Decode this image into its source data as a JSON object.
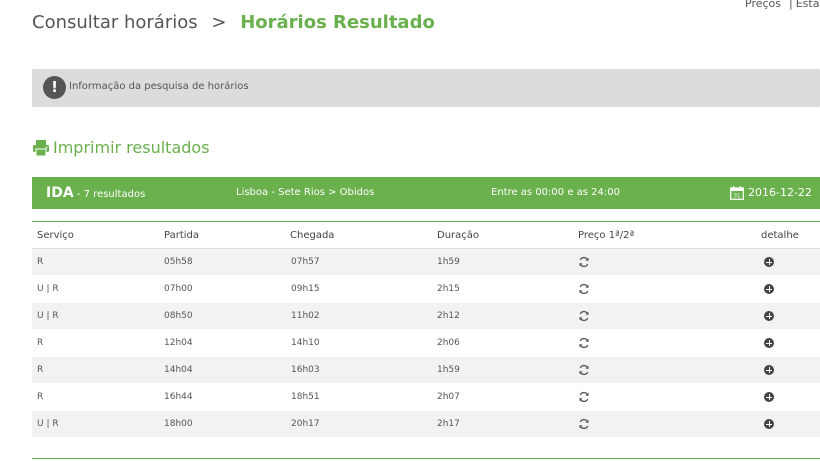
{
  "top_links": {
    "prices": "Preços",
    "stations": "Estaç"
  },
  "breadcrumb": {
    "root": "Consultar horários",
    "separator": ">",
    "current": "Horários Resultado"
  },
  "info_bar": {
    "icon": "exclamation-icon",
    "text": "Informação da pesquisa de horários"
  },
  "print": {
    "icon": "printer-icon",
    "label": "Imprimir resultados"
  },
  "result_bar": {
    "direction": "IDA",
    "count": " - 7 resultados",
    "route": "Lisboa - Sete Rios > Obidos",
    "time_range": "Entre as 00:00 e as 24:00",
    "date": "2016-12-22",
    "date_icon": "calendar-icon"
  },
  "table": {
    "columns": [
      "Serviço",
      "Partida",
      "Chegada",
      "Duração",
      "Preço 1ª/2ª",
      "detalhe"
    ],
    "rows": [
      {
        "service": "R",
        "departure": "05h58",
        "arrival": "07h57",
        "duration": "1h59"
      },
      {
        "service": "U | R",
        "departure": "07h00",
        "arrival": "09h15",
        "duration": "2h15"
      },
      {
        "service": "U | R",
        "departure": "08h50",
        "arrival": "11h02",
        "duration": "2h12"
      },
      {
        "service": "R",
        "departure": "12h04",
        "arrival": "14h10",
        "duration": "2h06"
      },
      {
        "service": "R",
        "departure": "14h04",
        "arrival": "16h03",
        "duration": "1h59"
      },
      {
        "service": "R",
        "departure": "16h44",
        "arrival": "18h51",
        "duration": "2h07"
      },
      {
        "service": "U | R",
        "departure": "18h00",
        "arrival": "20h17",
        "duration": "2h17"
      }
    ]
  },
  "colors": {
    "accent": "#6ab04c",
    "info_bg": "#dcdcdc",
    "row_alt": "#f2f2f2"
  }
}
